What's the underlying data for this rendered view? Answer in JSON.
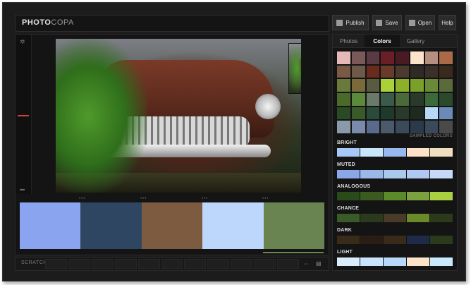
{
  "app": {
    "logo_bold": "PHOTO",
    "logo_light": "COPA"
  },
  "toolbar": {
    "publish": "Publish",
    "save": "Save",
    "open": "Open",
    "help": "Help"
  },
  "icons": {
    "publish": "publish-icon",
    "save": "save-icon",
    "open": "open-icon",
    "settings": "gear-icon",
    "swap": "swap-icon",
    "keyboard": "keyboard-icon"
  },
  "tabs": [
    "Photos",
    "Colors",
    "Gallery"
  ],
  "active_tab": "Colors",
  "main_swatches": [
    "#8aa4f0",
    "#2f4662",
    "#7d5b40",
    "#bcd7fb",
    "#6a8451"
  ],
  "sampled_label": "SAMPLED COLORS",
  "sampled_grid": [
    "#e6b8b8",
    "#7a5a58",
    "#5a3a44",
    "#6a1e26",
    "#4a1a22",
    "#fde3c9",
    "#b59080",
    "#aa6a48",
    "#7a5a44",
    "#6e5a48",
    "#6a2a1e",
    "#6a3a2a",
    "#4a3a30",
    "#2e2a26",
    "#3a3028",
    "#3a2a1e",
    "#6a7a3a",
    "#7a6a3a",
    "#5a5a40",
    "#aad03a",
    "#8cb02a",
    "#7aa02a",
    "#6a8a3a",
    "#5a6a3a",
    "#4a6a2a",
    "#5a8a3a",
    "#6a7a6a",
    "#3a5a4a",
    "#4a6a3a",
    "#2a3a2a",
    "#3a6a3a",
    "#2a4a2a",
    "#2a4a24",
    "#3a5a2a",
    "#2a4a3a",
    "#1e3a2a",
    "#2a3a2a",
    "#1e2a1e",
    "#b8d8f8",
    "#6a8ab8",
    "#8a9aaa",
    "#7a8aaa",
    "#5a6a8a",
    "#4a5a6a",
    "#3a4a5a",
    "#2a3a4a",
    "#3a4a5a",
    "#4a4a4a"
  ],
  "rules": [
    {
      "label": "BRIGHT",
      "colors": [
        "#a8c8f8",
        "#c8e8fa",
        "#98b8f0",
        "#fce0c8",
        "#f0dcc0"
      ]
    },
    {
      "label": "MUTED",
      "colors": [
        "#8aa8e8",
        "#9ab8e8",
        "#a8c8ee",
        "#b0c8f4",
        "#c8d8f8"
      ]
    },
    {
      "label": "ANALOGOUS",
      "colors": [
        "#2a4a1a",
        "#3a5a1e",
        "#5a8a2a",
        "#7aa040",
        "#a8d040"
      ]
    },
    {
      "label": "CHANCE",
      "colors": [
        "#3a5a2a",
        "#2a3a1a",
        "#4a3a28",
        "#6a8a2a",
        "#2a3a1a"
      ]
    },
    {
      "label": "DARK",
      "colors": [
        "#3a2a1a",
        "#2a1e14",
        "#3a2a1a",
        "#1e2a4a",
        "#2a3a1a"
      ]
    },
    {
      "label": "LIGHT",
      "colors": [
        "#d8ecfc",
        "#c8e4fc",
        "#b8d8fa",
        "#fce2c8",
        "#c8e8fc"
      ]
    }
  ],
  "scratch_label": "SCRATCH"
}
